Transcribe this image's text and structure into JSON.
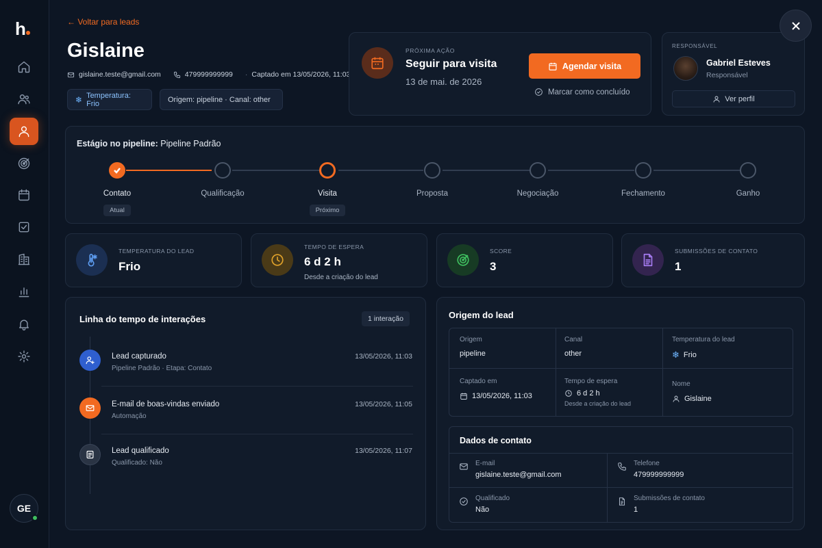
{
  "sidebar": {
    "logo": "h",
    "items": [
      {
        "name": "home",
        "icon": "home-icon"
      },
      {
        "name": "users",
        "icon": "users-icon"
      },
      {
        "name": "leads",
        "icon": "user-icon",
        "active": true
      },
      {
        "name": "targets",
        "icon": "target-icon"
      },
      {
        "name": "calendar",
        "icon": "calendar-icon"
      },
      {
        "name": "tasks",
        "icon": "checkbox-icon"
      },
      {
        "name": "companies",
        "icon": "building-icon"
      },
      {
        "name": "reports",
        "icon": "bar-chart-icon"
      },
      {
        "name": "notifications",
        "icon": "bell-icon"
      },
      {
        "name": "settings",
        "icon": "gear-icon"
      }
    ],
    "user_initials": "GE"
  },
  "header": {
    "back_label": "← Voltar para leads",
    "title": "Gislaine",
    "email": "gislaine.teste@gmail.com",
    "phone": "479999999999",
    "captured": "Captado em 13/05/2026, 11:03",
    "chip_temperature": "Temperatura: Frio",
    "chip_origin": "Origem: pipeline · Canal: other"
  },
  "next_action": {
    "eyebrow": "PRÓXIMA AÇÃO",
    "title": "Seguir para visita",
    "date": "13 de mai. de 2026",
    "button": "Agendar visita",
    "mark_done": "Marcar como concluído"
  },
  "responsible": {
    "eyebrow": "RESPONSÁVEL",
    "name": "Gabriel Esteves",
    "role": "Responsável",
    "button": "Ver perfil"
  },
  "pipeline": {
    "label": "Estágio no pipeline:",
    "name": "Pipeline Padrão",
    "stages": [
      {
        "label": "Contato",
        "tag": "Atual",
        "state": "done"
      },
      {
        "label": "Qualificação",
        "tag": "",
        "state": "pending"
      },
      {
        "label": "Visita",
        "tag": "Próximo",
        "state": "next"
      },
      {
        "label": "Proposta",
        "tag": "",
        "state": "pending"
      },
      {
        "label": "Negociação",
        "tag": "",
        "state": "pending"
      },
      {
        "label": "Fechamento",
        "tag": "",
        "state": "pending"
      },
      {
        "label": "Ganho",
        "tag": "",
        "state": "pending"
      }
    ]
  },
  "stats": [
    {
      "eyebrow": "TEMPERATURA DO LEAD",
      "value": "Frio",
      "sub": "",
      "icon": "thermometer-icon",
      "color": "#3d7fe0"
    },
    {
      "eyebrow": "TEMPO DE ESPERA",
      "value": "6 d 2 h",
      "sub": "Desde a criação do lead",
      "icon": "clock-icon",
      "color": "#e0a22a"
    },
    {
      "eyebrow": "SCORE",
      "value": "3",
      "sub": "",
      "icon": "target-icon",
      "color": "#3fbf5f"
    },
    {
      "eyebrow": "SUBMISSÕES DE CONTATO",
      "value": "1",
      "sub": "",
      "icon": "document-icon",
      "color": "#9b6be0"
    }
  ],
  "timeline": {
    "title": "Linha do tempo de interações",
    "badge": "1 interação",
    "items": [
      {
        "title": "Lead capturado",
        "sub": "Pipeline Padrão · Etapa: Contato",
        "time": "13/05/2026, 11:03",
        "icon": "user-plus-icon",
        "color": "#2f5fcf"
      },
      {
        "title": "E-mail de boas-vindas enviado",
        "sub": "Automação",
        "time": "13/05/2026, 11:05",
        "icon": "mail-icon",
        "color": "#f26a21"
      },
      {
        "title": "Lead qualificado",
        "sub": "Qualificado: Não",
        "time": "13/05/2026, 11:07",
        "icon": "note-icon",
        "color": "#2d3748"
      }
    ]
  },
  "origin": {
    "title": "Origem do lead",
    "cells": {
      "origem_k": "Origem",
      "origem_v": "pipeline",
      "canal_k": "Canal",
      "canal_v": "other",
      "temp_k": "Temperatura do lead",
      "temp_v": "Frio",
      "captado_k": "Captado em",
      "captado_v": "13/05/2026, 11:03",
      "espera_k": "Tempo de espera",
      "espera_v": "6 d 2 h",
      "espera_s": "Desde a criação do lead",
      "nome_k": "Nome",
      "nome_v": "Gislaine"
    }
  },
  "contact": {
    "title": "Dados de contato",
    "email_k": "E-mail",
    "email_v": "gislaine.teste@gmail.com",
    "phone_k": "Telefone",
    "phone_v": "479999999999",
    "qual_k": "Qualificado",
    "qual_v": "Não",
    "subs_k": "Submissões de contato",
    "subs_v": "1"
  },
  "colors": {
    "accent": "#f26a21",
    "background": "#0d1624",
    "card": "#111b2a"
  }
}
